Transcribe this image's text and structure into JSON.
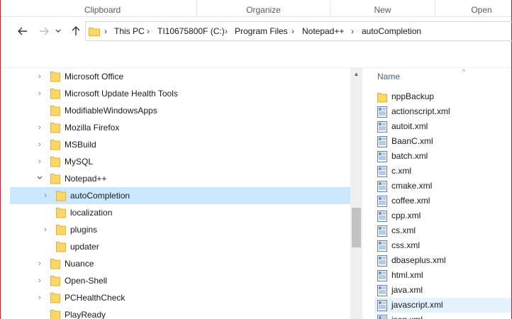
{
  "ribbon": {
    "groups": [
      "Clipboard",
      "Organize",
      "New",
      "Open"
    ]
  },
  "nav": {
    "back_icon": "back-arrow-icon",
    "forward_icon": "forward-arrow-icon",
    "recent_icon": "chevron-down-icon",
    "up_icon": "up-arrow-icon"
  },
  "address": {
    "crumbs": [
      "This PC",
      "TI10675800F (C:)",
      "Program Files",
      "Notepad++",
      "autoCompletion"
    ]
  },
  "tree": {
    "items": [
      {
        "label": "Microsoft Office",
        "expanded": false,
        "has_children": true,
        "level": 0
      },
      {
        "label": "Microsoft Update Health Tools",
        "expanded": false,
        "has_children": true,
        "level": 0
      },
      {
        "label": "ModifiableWindowsApps",
        "expanded": false,
        "has_children": false,
        "level": 0
      },
      {
        "label": "Mozilla Firefox",
        "expanded": false,
        "has_children": true,
        "level": 0
      },
      {
        "label": "MSBuild",
        "expanded": false,
        "has_children": true,
        "level": 0
      },
      {
        "label": "MySQL",
        "expanded": false,
        "has_children": true,
        "level": 0
      },
      {
        "label": "Notepad++",
        "expanded": true,
        "has_children": true,
        "level": 0
      },
      {
        "label": "autoCompletion",
        "expanded": false,
        "has_children": true,
        "level": 1,
        "selected": true
      },
      {
        "label": "localization",
        "expanded": false,
        "has_children": false,
        "level": 1
      },
      {
        "label": "plugins",
        "expanded": false,
        "has_children": true,
        "level": 1
      },
      {
        "label": "updater",
        "expanded": false,
        "has_children": false,
        "level": 1
      },
      {
        "label": "Nuance",
        "expanded": false,
        "has_children": true,
        "level": 0
      },
      {
        "label": "Open-Shell",
        "expanded": false,
        "has_children": true,
        "level": 0
      },
      {
        "label": "PCHealthCheck",
        "expanded": false,
        "has_children": true,
        "level": 0
      },
      {
        "label": "PlayReady",
        "expanded": false,
        "has_children": false,
        "level": 0
      }
    ]
  },
  "files": {
    "column_name": "Name",
    "sort_icon": "sort-ascending-caret-icon",
    "items": [
      {
        "label": "nppBackup",
        "type": "folder"
      },
      {
        "label": "actionscript.xml",
        "type": "xml"
      },
      {
        "label": "autoit.xml",
        "type": "xml"
      },
      {
        "label": "BaanC.xml",
        "type": "xml"
      },
      {
        "label": "batch.xml",
        "type": "xml"
      },
      {
        "label": "c.xml",
        "type": "xml"
      },
      {
        "label": "cmake.xml",
        "type": "xml"
      },
      {
        "label": "coffee.xml",
        "type": "xml"
      },
      {
        "label": "cpp.xml",
        "type": "xml"
      },
      {
        "label": "cs.xml",
        "type": "xml"
      },
      {
        "label": "css.xml",
        "type": "xml"
      },
      {
        "label": "dbaseplus.xml",
        "type": "xml"
      },
      {
        "label": "html.xml",
        "type": "xml"
      },
      {
        "label": "java.xml",
        "type": "xml"
      },
      {
        "label": "javascript.xml",
        "type": "xml",
        "hover": true
      },
      {
        "label": "json.xml",
        "type": "xml"
      }
    ]
  },
  "colors": {
    "selected_bg": "#cce8ff",
    "hover_bg": "#e5f3ff",
    "folder_yellow": "#ffd766",
    "window_border": "#e81123"
  }
}
